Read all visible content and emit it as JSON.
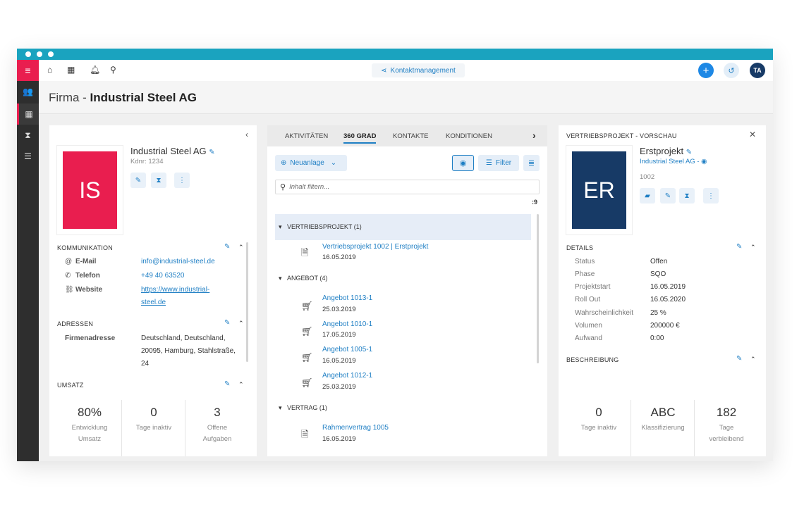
{
  "topbar": {
    "center_label": "Kontaktmanagement",
    "avatar_initials": "TA"
  },
  "header": {
    "prefix": "Firma - ",
    "company": "Industrial Steel AG"
  },
  "left": {
    "name": "Industrial Steel AG",
    "kdnr": "Kdnr: 1234",
    "initials": "IS",
    "kommunikation": {
      "title": "KOMMUNIKATION",
      "rows": [
        {
          "label": "E-Mail",
          "value": "info@industrial-steel.de"
        },
        {
          "label": "Telefon",
          "value": "+49 40 63520"
        },
        {
          "label": "Website",
          "value": "https://www.industrial-",
          "value2": "steel.de"
        }
      ]
    },
    "adressen": {
      "title": "ADRESSEN",
      "label": "Firmenadresse",
      "lines": [
        "Deutschland, Deutschland,",
        "20095, Hamburg, Stahlstraße,",
        "24"
      ]
    },
    "umsatz": {
      "title": "UMSATZ",
      "stats": [
        {
          "value": "80%",
          "label1": "Entwicklung",
          "label2": "Umsatz"
        },
        {
          "value": "0",
          "label1": "Tage inaktiv",
          "label2": ""
        },
        {
          "value": "3",
          "label1": "Offene",
          "label2": "Aufgaben"
        }
      ]
    }
  },
  "middle": {
    "tabs": [
      "AKTIVITÄTEN",
      "360 GRAD",
      "KONTAKTE",
      "KONDITIONEN"
    ],
    "active_tab": "360 GRAD",
    "new_button": "Neuanlage",
    "filter_button": "Filter",
    "search_placeholder": "Inhalt filtern...",
    "count": ":9",
    "groups": {
      "vp": "VERTRIEBSPROJEKT (1)",
      "angebot": "ANGEBOT (4)",
      "vertrag": "VERTRAG (1)"
    },
    "entries": [
      {
        "title": "Vertriebsprojekt 1002 | Erstprojekt",
        "date": "16.05.2019"
      },
      {
        "title": "Angebot 1013-1",
        "date": "25.03.2019"
      },
      {
        "title": "Angebot 1010-1",
        "date": "17.05.2019"
      },
      {
        "title": "Angebot 1005-1",
        "date": "16.05.2019"
      },
      {
        "title": "Angebot 1012-1",
        "date": "25.03.2019"
      },
      {
        "title": "Rahmenvertrag 1005",
        "date": "16.05.2019"
      }
    ]
  },
  "right": {
    "title": "VERTRIEBSPROJEKT - VORSCHAU",
    "name": "Erstprojekt",
    "company_link": "Industrial Steel AG -",
    "number": "1002",
    "initials": "ER",
    "details_title": "DETAILS",
    "details": [
      {
        "label": "Status",
        "value": "Offen"
      },
      {
        "label": "Phase",
        "value": "SQO"
      },
      {
        "label": "Projektstart",
        "value": "16.05.2019"
      },
      {
        "label": "Roll Out",
        "value": "16.05.2020"
      },
      {
        "label": "Wahrscheinlichkeit",
        "value": "25 %"
      },
      {
        "label": "Volumen",
        "value": "200000 €"
      },
      {
        "label": "Aufwand",
        "value": "0:00"
      }
    ],
    "beschreibung_title": "BESCHREIBUNG",
    "stats": [
      {
        "value": "0",
        "label1": "Tage inaktiv",
        "label2": ""
      },
      {
        "value": "ABC",
        "label1": "Klassifizierung",
        "label2": ""
      },
      {
        "value": "182",
        "label1": "Tage",
        "label2": "verbleibend"
      }
    ]
  },
  "colors": {
    "accent": "#1aa3bf",
    "brand_red": "#e91e4f",
    "link_blue": "#1f7fc4",
    "dark_navy": "#173a66"
  }
}
